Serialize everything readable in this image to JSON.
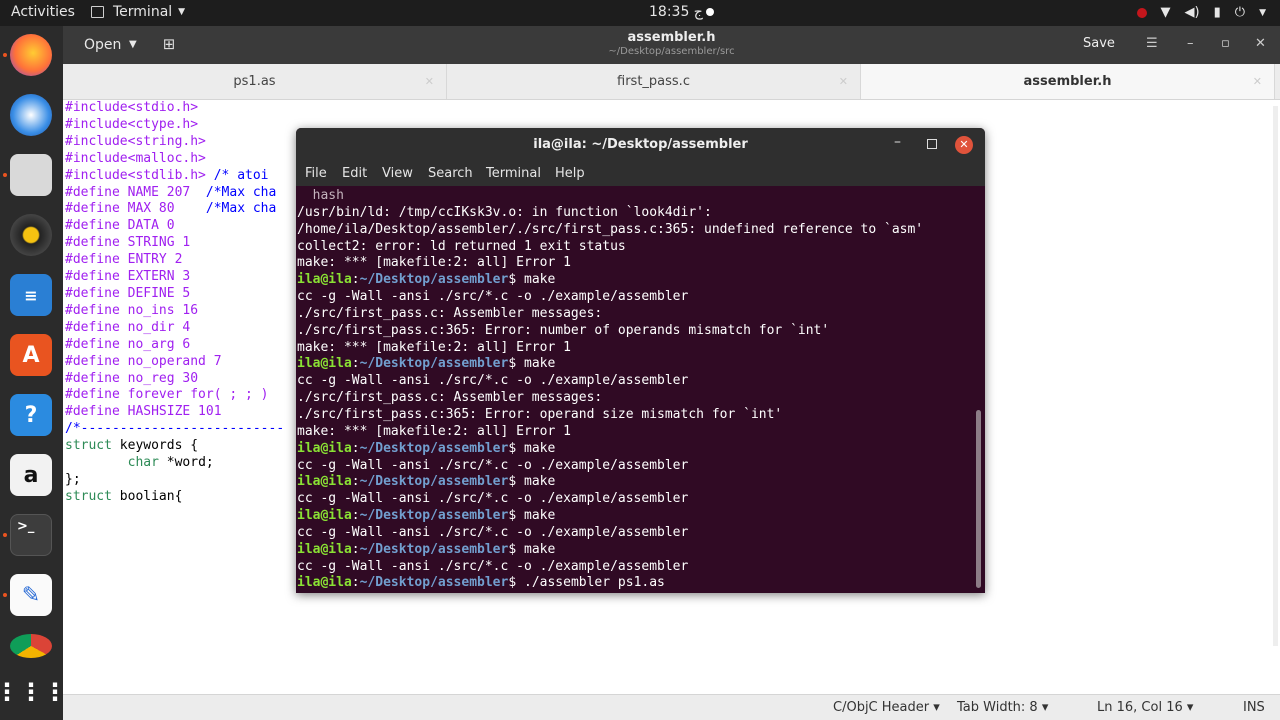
{
  "topbar": {
    "activities": "Activities",
    "app_name": "Terminal",
    "clock": "18:35 ج"
  },
  "dock": {
    "items": [
      "firefox-icon",
      "thunderbird-icon",
      "files-icon",
      "rhythmbox-icon",
      "libreoffice-writer-icon",
      "software-center-icon",
      "help-icon",
      "amazon-icon",
      "terminal-icon",
      "text-editor-icon",
      "chrome-icon",
      "show-apps-icon"
    ]
  },
  "gedit": {
    "open_label": "Open",
    "title": "assembler.h",
    "path": "~/Desktop/assembler/src",
    "save_label": "Save",
    "tabs": [
      {
        "label": "ps1.as"
      },
      {
        "label": "first_pass.c"
      },
      {
        "label": "assembler.h"
      }
    ],
    "code_lines": [
      "#include<stdio.h>",
      "#include<ctype.h>",
      "#include<string.h>",
      "#include<malloc.h>",
      "#include<stdlib.h> /* atoi",
      "",
      "",
      "#define NAME 207  /*Max cha",
      "",
      "#define MAX 80    /*Max cha",
      "",
      "#define DATA 0",
      "#define STRING 1",
      "#define ENTRY 2",
      "#define EXTERN 3",
      "#define DEFINE 5",
      "",
      "#define no_ins 16",
      "#define no_dir 4",
      "#define no_arg 6",
      "#define no_operand 7",
      "#define no_reg 30",
      "",
      "#define forever for( ; ; )",
      "",
      "#define HASHSIZE 101",
      "",
      "",
      "/*--------------------------",
      "",
      "struct keywords {",
      "        char *word;",
      "};",
      "",
      "struct boolian{"
    ],
    "status": {
      "language": "C/ObjC Header",
      "tab_width": "Tab Width: 8",
      "position": "Ln 16, Col 16",
      "mode": "INS"
    }
  },
  "terminal": {
    "title": "ila@ila: ~/Desktop/assembler",
    "menu": [
      "File",
      "Edit",
      "View",
      "Search",
      "Terminal",
      "Help"
    ],
    "prompt_user": "ila@ila",
    "prompt_path": "~/Desktop/assembler",
    "lines": [
      {
        "t": "out",
        "text": "  hash"
      },
      {
        "t": "out",
        "text": "/usr/bin/ld: /tmp/ccIKsk3v.o: in function `look4dir':"
      },
      {
        "t": "out",
        "text": "/home/ila/Desktop/assembler/./src/first_pass.c:365: undefined reference to `asm'"
      },
      {
        "t": "out",
        "text": "collect2: error: ld returned 1 exit status"
      },
      {
        "t": "out",
        "text": "make: *** [makefile:2: all] Error 1"
      },
      {
        "t": "cmd",
        "text": "make"
      },
      {
        "t": "out",
        "text": "cc -g -Wall -ansi ./src/*.c -o ./example/assembler"
      },
      {
        "t": "out",
        "text": "./src/first_pass.c: Assembler messages:"
      },
      {
        "t": "out",
        "text": "./src/first_pass.c:365: Error: number of operands mismatch for `int'"
      },
      {
        "t": "out",
        "text": "make: *** [makefile:2: all] Error 1"
      },
      {
        "t": "cmd",
        "text": "make"
      },
      {
        "t": "out",
        "text": "cc -g -Wall -ansi ./src/*.c -o ./example/assembler"
      },
      {
        "t": "out",
        "text": "./src/first_pass.c: Assembler messages:"
      },
      {
        "t": "out",
        "text": "./src/first_pass.c:365: Error: operand size mismatch for `int'"
      },
      {
        "t": "out",
        "text": "make: *** [makefile:2: all] Error 1"
      },
      {
        "t": "cmd",
        "text": "make"
      },
      {
        "t": "out",
        "text": "cc -g -Wall -ansi ./src/*.c -o ./example/assembler"
      },
      {
        "t": "cmd",
        "text": "make"
      },
      {
        "t": "out",
        "text": "cc -g -Wall -ansi ./src/*.c -o ./example/assembler"
      },
      {
        "t": "cmd",
        "text": "make"
      },
      {
        "t": "out",
        "text": "cc -g -Wall -ansi ./src/*.c -o ./example/assembler"
      },
      {
        "t": "cmd",
        "text": "make"
      },
      {
        "t": "out",
        "text": "cc -g -Wall -ansi ./src/*.c -o ./example/assembler"
      },
      {
        "t": "cmd",
        "text": "./assembler ps1.as"
      }
    ]
  }
}
